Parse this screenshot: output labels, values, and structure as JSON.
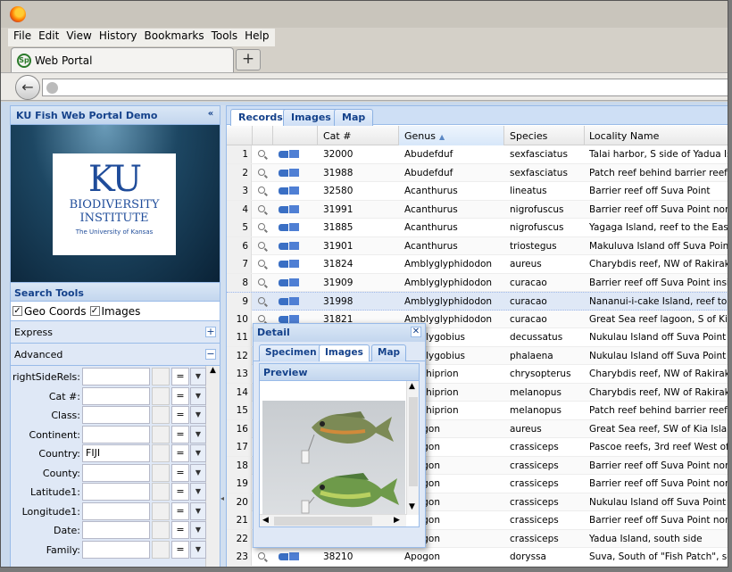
{
  "menu": [
    "File",
    "Edit",
    "View",
    "History",
    "Bookmarks",
    "Tools",
    "Help"
  ],
  "browser_tab": {
    "title": "Web Portal",
    "icon": "Sp"
  },
  "left_panel": {
    "title": "KU Fish Web Portal Demo",
    "logo": {
      "ku": "KU",
      "line1": "BIODIVERSITY",
      "line2": "INSTITUTE",
      "line3": "The University of Kansas"
    },
    "search_tools": "Search Tools",
    "geo_coords": "Geo Coords",
    "images": "Images",
    "express": "Express",
    "advanced": "Advanced",
    "fields": [
      {
        "label": "rightSideRels:",
        "value": ""
      },
      {
        "label": "Cat #:",
        "value": ""
      },
      {
        "label": "Class:",
        "value": ""
      },
      {
        "label": "Continent:",
        "value": ""
      },
      {
        "label": "Country:",
        "value": "FIJI"
      },
      {
        "label": "County:",
        "value": ""
      },
      {
        "label": "Latitude1:",
        "value": ""
      },
      {
        "label": "Longitude1:",
        "value": ""
      },
      {
        "label": "Date:",
        "value": ""
      },
      {
        "label": "Family:",
        "value": ""
      }
    ],
    "operator": "="
  },
  "grid": {
    "tabs": [
      "Records",
      "Images",
      "Map"
    ],
    "columns": {
      "cat": "Cat #",
      "genus": "Genus",
      "species": "Species",
      "locality": "Locality Name"
    },
    "rows": [
      {
        "n": "1",
        "cat": "32000",
        "genus": "Abudefduf",
        "species": "sexfasciatus",
        "loc": "Talai harbor, S side of Yadua Islan"
      },
      {
        "n": "2",
        "cat": "31988",
        "genus": "Abudefduf",
        "species": "sexfasciatus",
        "loc": "Patch reef behind barrier reef off S"
      },
      {
        "n": "3",
        "cat": "32580",
        "genus": "Acanthurus",
        "species": "lineatus",
        "loc": "Barrier reef off Suva Point"
      },
      {
        "n": "4",
        "cat": "31991",
        "genus": "Acanthurus",
        "species": "nigrofuscus",
        "loc": "Barrier reef off Suva Point north o"
      },
      {
        "n": "5",
        "cat": "31885",
        "genus": "Acanthurus",
        "species": "nigrofuscus",
        "loc": "Yagaga Island, reef to the East and"
      },
      {
        "n": "6",
        "cat": "31901",
        "genus": "Acanthurus",
        "species": "triostegus",
        "loc": "Makuluva Island off Suva Point"
      },
      {
        "n": "7",
        "cat": "31824",
        "genus": "Amblyglyphidodon",
        "species": "aureus",
        "loc": "Charybdis reef, NW of Rakiraki, S"
      },
      {
        "n": "8",
        "cat": "31909",
        "genus": "Amblyglyphidodon",
        "species": "curacao",
        "loc": "Barrier reef off Suva Point inside la"
      },
      {
        "n": "9",
        "cat": "31998",
        "genus": "Amblyglyphidodon",
        "species": "curacao",
        "loc": "Nananui-i-cake Island, reef to the"
      },
      {
        "n": "10",
        "cat": "31821",
        "genus": "Amblyglyphidodon",
        "species": "curacao",
        "loc": "Great Sea reef lagoon, S of Kia Isl"
      },
      {
        "n": "11",
        "cat": "",
        "genus": "Amblygobius",
        "species": "decussatus",
        "loc": "Nukulau Island off Suva Point"
      },
      {
        "n": "12",
        "cat": "",
        "genus": "Amblygobius",
        "species": "phalaena",
        "loc": "Nukulau Island off Suva Point"
      },
      {
        "n": "13",
        "cat": "",
        "genus": "Amphiprion",
        "species": "chrysopterus",
        "loc": "Charybdis reef, NW of Rakiraki, S"
      },
      {
        "n": "14",
        "cat": "",
        "genus": "Amphiprion",
        "species": "melanopus",
        "loc": "Charybdis reef, NW of Rakiraki, S"
      },
      {
        "n": "15",
        "cat": "",
        "genus": "Amphiprion",
        "species": "melanopus",
        "loc": "Patch reef behind barrier reef off S"
      },
      {
        "n": "16",
        "cat": "",
        "genus": "Apogon",
        "species": "aureus",
        "loc": "Great Sea reef, SW of Kia Island"
      },
      {
        "n": "17",
        "cat": "",
        "genus": "Apogon",
        "species": "crassiceps",
        "loc": "Pascoe reefs, 3rd reef West of Yad"
      },
      {
        "n": "18",
        "cat": "",
        "genus": "Apogon",
        "species": "crassiceps",
        "loc": "Barrier reef off Suva Point north o"
      },
      {
        "n": "19",
        "cat": "",
        "genus": "Apogon",
        "species": "crassiceps",
        "loc": "Barrier reef off Suva Point north o"
      },
      {
        "n": "20",
        "cat": "",
        "genus": "Apogon",
        "species": "crassiceps",
        "loc": "Nukulau Island off Suva Point"
      },
      {
        "n": "21",
        "cat": "",
        "genus": "Apogon",
        "species": "crassiceps",
        "loc": "Barrier reef off Suva Point north o"
      },
      {
        "n": "22",
        "cat": "",
        "genus": "Apogon",
        "species": "crassiceps",
        "loc": "Yadua Island, south side"
      },
      {
        "n": "23",
        "cat": "38210",
        "genus": "Apogon",
        "species": "doryssa",
        "loc": "Suva, South of \"Fish Patch\", south"
      }
    ]
  },
  "detail": {
    "title": "Detail",
    "tabs": [
      "Specimen",
      "Images",
      "Map"
    ],
    "preview": "Preview"
  }
}
